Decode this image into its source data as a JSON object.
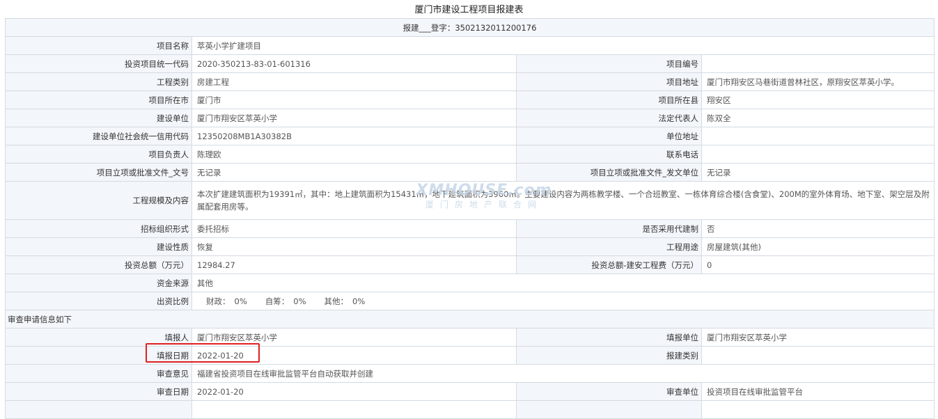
{
  "title": "厦门市建设工程项目报建表",
  "registration": "报建___登字：3502132011200176",
  "rows": {
    "project_name": {
      "label": "项目名称",
      "value": "萃英小学扩建项目"
    },
    "unified_code": {
      "label": "投资项目统一代码",
      "value": "2020-350213-83-01-601316"
    },
    "project_number": {
      "label": "项目编号",
      "value": ""
    },
    "engineering_type": {
      "label": "工程类别",
      "value": "房建工程"
    },
    "project_address": {
      "label": "项目地址",
      "value": "厦门市翔安区马巷街道曾林社区，原翔安区萃英小学。"
    },
    "city": {
      "label": "项目所在市",
      "value": "厦门市"
    },
    "county": {
      "label": "项目所在县",
      "value": "翔安区"
    },
    "builder": {
      "label": "建设单位",
      "value": "厦门市翔安区萃英小学"
    },
    "legal_rep": {
      "label": "法定代表人",
      "value": "陈双全"
    },
    "credit_code": {
      "label": "建设单位社会统一信用代码",
      "value": "12350208MB1A30382B"
    },
    "unit_address": {
      "label": "单位地址",
      "value": ""
    },
    "manager": {
      "label": "项目负责人",
      "value": "陈理欧"
    },
    "phone": {
      "label": "联系电话",
      "value": ""
    },
    "approval_doc": {
      "label": "项目立项或批准文件_文号",
      "value": "无记录"
    },
    "approval_unit": {
      "label": "项目立项或批准文件_发文单位",
      "value": "无记录"
    },
    "scale": {
      "label": "工程规模及内容",
      "value": "本次扩建建筑面积为19391㎡，其中：地上建筑面积为15431㎡，地下建筑面积为3960㎡。主要建设内容为两栋教学楼、一个合班教室、一栋体育综合楼(含食堂)、200M的室外体育场、地下室、架空层及附属配套用房等。"
    },
    "bidding_form": {
      "label": "招标组织形式",
      "value": "委托招标"
    },
    "agent_build": {
      "label": "是否采用代建制",
      "value": "否"
    },
    "nature": {
      "label": "建设性质",
      "value": "恢复"
    },
    "usage": {
      "label": "工程用途",
      "value": "房屋建筑(其他)"
    },
    "investment": {
      "label": "投资总额（万元）",
      "value": "12984.27"
    },
    "investment_install": {
      "label": "投资总额-建安工程费（万元）",
      "value": "0"
    },
    "fund_source": {
      "label": "资金来源",
      "value": "其他"
    },
    "ratio": {
      "label": "出资比例",
      "fiscal_label": "财政：",
      "fiscal": "0%",
      "self_label": "自筹：",
      "self": "0%",
      "other_label": "其他：",
      "other": "0%"
    }
  },
  "review_section": "审查申请信息如下",
  "review": {
    "filler": {
      "label": "填报人",
      "value": "厦门市翔安区萃英小学"
    },
    "filler_unit": {
      "label": "填报单位",
      "value": "厦门市翔安区萃英小学"
    },
    "fill_date": {
      "label": "填报日期",
      "value": "2022-01-20"
    },
    "report_type": {
      "label": "报建类别",
      "value": ""
    },
    "opinion": {
      "label": "审查意见",
      "value": "福建省投资项目在线审批监管平台自动获取并创建"
    },
    "review_date": {
      "label": "审查日期",
      "value": "2022-01-20"
    },
    "review_unit": {
      "label": "审查单位",
      "value": "投资项目在线审批监管平台"
    }
  },
  "watermark": {
    "line1": "XMHOUSE.com",
    "line2": "厦门房地产联合网"
  },
  "highlight_color": "#e02020"
}
